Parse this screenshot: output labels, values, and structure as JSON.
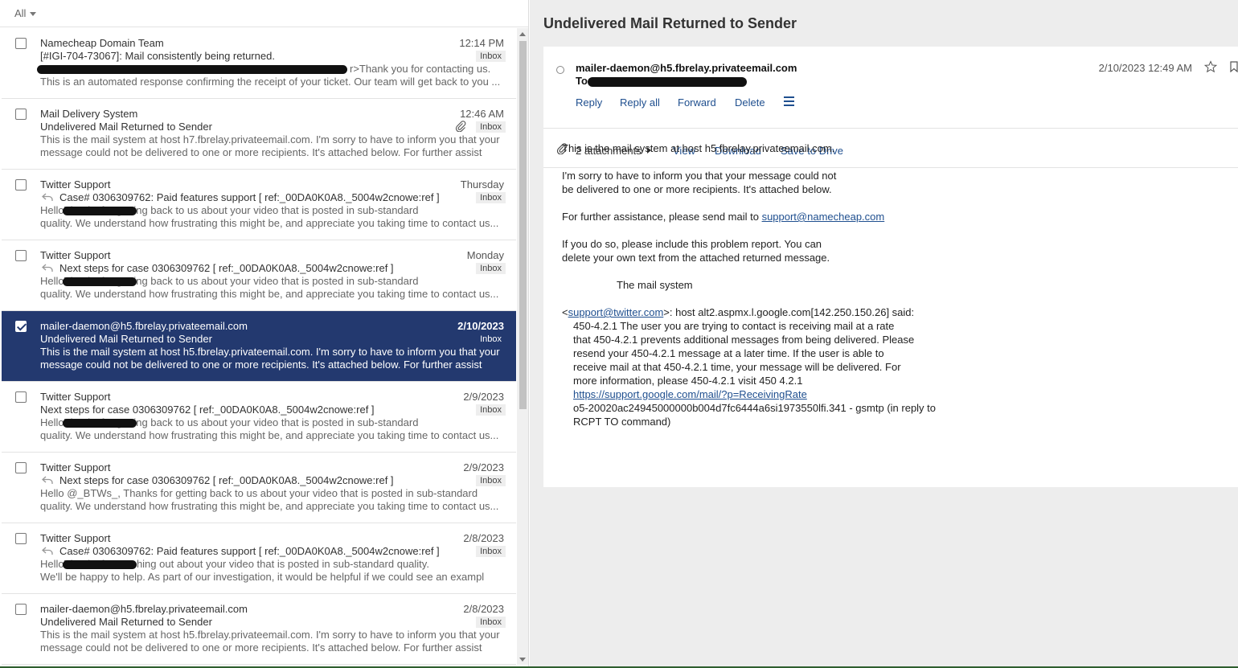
{
  "filter": {
    "label": "All"
  },
  "emails": [
    {
      "sender": "Namecheap Domain Team",
      "date": "12:14 PM",
      "subject": "[#IGI-704-73067]: Mail consistently being returned.",
      "reply": false,
      "attachment": false,
      "badge": "Inbox",
      "preview1_pre": "",
      "preview1_post": "r>Thank you for contacting us.",
      "preview2": "This is an automated response confirming the receipt of your ticket. Our team will get back to you ...",
      "selected": false
    },
    {
      "sender": "Mail Delivery System",
      "date": "12:46 AM",
      "subject": "Undelivered Mail Returned to Sender",
      "reply": false,
      "attachment": true,
      "badge": "Inbox",
      "preview1_pre": "This is the mail system at host h7.fbrelay.privateemail.com. I'm sorry to have to inform you that your",
      "preview1_post": "",
      "preview2": "message could not be delivered to one or more recipients. It's attached below. For further assist",
      "selected": false
    },
    {
      "sender": "Twitter Support",
      "date": "Thursday",
      "subject": "Case# 0306309762: Paid features support [ ref:_00DA0K0A8._5004w2cnowe:ref ]",
      "reply": true,
      "attachment": false,
      "badge": "Inbox",
      "preview1_pre": "Hello",
      "preview1_post": "Thanks for getting back to us about your video that is posted in sub-standard",
      "preview2": "quality. We understand how frustrating this might be, and appreciate you taking time to contact us...",
      "selected": false
    },
    {
      "sender": "Twitter Support",
      "date": "Monday",
      "subject": "Next steps for case 0306309762 [ ref:_00DA0K0A8._5004w2cnowe:ref ]",
      "reply": true,
      "attachment": false,
      "badge": "Inbox",
      "preview1_pre": "Hello",
      "preview1_post": "Thanks for getting back to us about your video that is posted in sub-standard",
      "preview2": "quality. We understand how frustrating this might be, and appreciate you taking time to contact us...",
      "selected": false
    },
    {
      "sender": "mailer-daemon@h5.fbrelay.privateemail.com",
      "date": "2/10/2023",
      "subject": "Undelivered Mail Returned to Sender",
      "reply": false,
      "attachment": false,
      "badge": "Inbox",
      "preview1_pre": "This is the mail system at host h5.fbrelay.privateemail.com. I'm sorry to have to inform you that your",
      "preview1_post": "",
      "preview2": "message could not be delivered to one or more recipients. It's attached below. For further assist",
      "selected": true
    },
    {
      "sender": "Twitter Support",
      "date": "2/9/2023",
      "subject": "Next steps for case 0306309762 [ ref:_00DA0K0A8._5004w2cnowe:ref ]",
      "reply": false,
      "attachment": false,
      "badge": "Inbox",
      "preview1_pre": "Hello",
      "preview1_post": "Thanks for getting back to us about your video that is posted in sub-standard",
      "preview2": "quality. We understand how frustrating this might be, and appreciate you taking time to contact us...",
      "selected": false
    },
    {
      "sender": "Twitter Support",
      "date": "2/9/2023",
      "subject": "Next steps for case 0306309762 [ ref:_00DA0K0A8._5004w2cnowe:ref ]",
      "reply": true,
      "attachment": false,
      "badge": "Inbox",
      "preview1_pre": "Hello @_BTWs_, Thanks for getting back to us about your video that is posted in sub-standard",
      "preview1_post": "",
      "preview2": "quality. We understand how frustrating this might be, and appreciate you taking time to contact us...",
      "selected": false
    },
    {
      "sender": "Twitter Support",
      "date": "2/8/2023",
      "subject": "Case# 0306309762: Paid features support [ ref:_00DA0K0A8._5004w2cnowe:ref ]",
      "reply": true,
      "attachment": false,
      "badge": "Inbox",
      "preview1_pre": "Hello",
      "preview1_post": "Thanks for reaching out about your video that is posted in sub-standard quality.",
      "preview2": "We'll be happy to help. As part of our investigation, it would be helpful if we could see an exampl",
      "selected": false
    },
    {
      "sender": "mailer-daemon@h5.fbrelay.privateemail.com",
      "date": "2/8/2023",
      "subject": "Undelivered Mail Returned to Sender",
      "reply": false,
      "attachment": false,
      "badge": "Inbox",
      "preview1_pre": "This is the mail system at host h5.fbrelay.privateemail.com. I'm sorry to have to inform you that your",
      "preview1_post": "",
      "preview2": "message could not be delivered to one or more recipients. It's attached below. For further assist",
      "selected": false
    }
  ],
  "message": {
    "title": "Undelivered Mail Returned to Sender",
    "from": "mailer-daemon@h5.fbrelay.privateemail.com",
    "to_label": "To",
    "date": "2/10/2023 12:49 AM",
    "actions": {
      "reply": "Reply",
      "reply_all": "Reply all",
      "forward": "Forward",
      "delete": "Delete"
    },
    "attachments": {
      "count": "2 attachments",
      "view": "View",
      "download": "Download",
      "save": "Save to Drive"
    },
    "body": {
      "l1": "This is the mail system at host h5.fbrelay.privateemail.com.",
      "l2": "I'm sorry to have to inform you that your message could not",
      "l3": "be delivered to one or more recipients. It's attached below.",
      "l4_pre": "For further assistance, please send mail to ",
      "l4_link": "support@namecheap.com",
      "l5": "If you do so, please include this problem report. You can",
      "l6": "delete your own text from the attached returned message.",
      "l7": "The mail system",
      "l8_pre": "<",
      "l8_link": "support@twitter.com",
      "l8_post": ">: host alt2.aspmx.l.google.com[142.250.150.26] said:",
      "l9": "450-4.2.1 The user you are trying to contact is receiving mail at a rate",
      "l10": "that 450-4.2.1 prevents additional messages from being delivered. Please",
      "l11": "resend your 450-4.2.1 message at a later time. If the user is able to",
      "l12": "receive mail at that 450-4.2.1 time, your message will be delivered. For",
      "l13": "more information, please 450-4.2.1 visit 450 4.2.1",
      "l14_link": "https://support.google.com/mail/?p=ReceivingRate",
      "l15": "o5-20020ac24945000000b004d7fc6444a6si1973550lfi.341 - gsmtp (in reply to",
      "l16": "RCPT TO command)"
    }
  },
  "colors": {
    "selected_row": "#23396f",
    "link": "#1f4f8f",
    "pane_bg": "#ededed"
  }
}
